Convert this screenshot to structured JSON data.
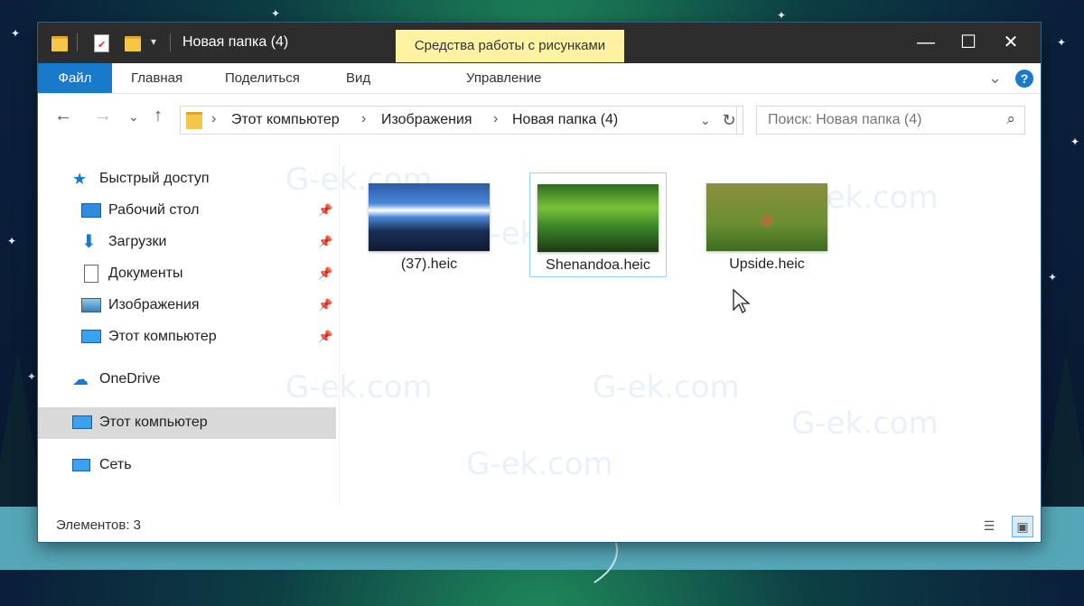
{
  "window": {
    "title": "Новая папка (4)",
    "context_tab": "Средства работы с рисунками",
    "minimize": "—",
    "maximize": "☐",
    "close": "✕"
  },
  "ribbon": {
    "file": "Файл",
    "tabs": [
      "Главная",
      "Поделиться",
      "Вид",
      "Управление"
    ],
    "help": "?",
    "expand": "⌄"
  },
  "nav": {
    "back": "←",
    "forward": "→",
    "recent": "⌄",
    "up": "↑",
    "breadcrumb": [
      "Этот компьютер",
      "Изображения",
      "Новая папка (4)"
    ],
    "search_placeholder": "Поиск: Новая папка (4)"
  },
  "sidebar": {
    "quick_access": "Быстрый доступ",
    "pinned": [
      "Рабочий стол",
      "Загрузки",
      "Документы",
      "Изображения",
      "Этот компьютер"
    ],
    "onedrive": "OneDrive",
    "this_pc": "Этот компьютер",
    "network": "Сеть"
  },
  "files": [
    {
      "name": "(37).heic",
      "selected": false
    },
    {
      "name": "Shenandoa.heic",
      "selected": true
    },
    {
      "name": "Upside.heic",
      "selected": false
    }
  ],
  "status": {
    "items": "Элементов: 3"
  },
  "watermark": "G-ek.com"
}
